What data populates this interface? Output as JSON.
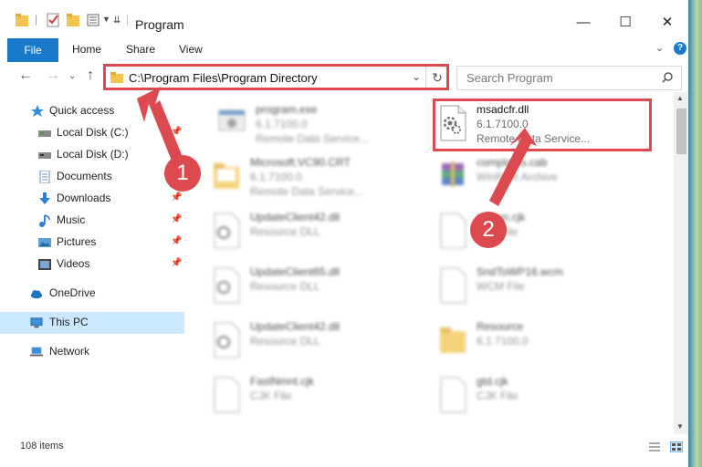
{
  "window": {
    "title": "Program",
    "minimize_glyph": "—",
    "maximize_glyph": "☐",
    "close_glyph": "✕"
  },
  "ribbon": {
    "file": "File",
    "tabs": [
      "Home",
      "Share",
      "View"
    ],
    "help_glyph": "?"
  },
  "address": {
    "path": "C:\\Program Files\\Program Directory",
    "search_placeholder": "Search Program"
  },
  "navigation": {
    "items": [
      {
        "label": "Quick access",
        "icon": "star-icon",
        "pinned": false
      },
      {
        "label": "Local Disk (C:)",
        "icon": "drive-icon",
        "pinned": true
      },
      {
        "label": "Local Disk (D:)",
        "icon": "drive-icon",
        "pinned": false
      },
      {
        "label": "Documents",
        "icon": "documents-icon",
        "pinned": true
      },
      {
        "label": "Downloads",
        "icon": "downloads-icon",
        "pinned": true
      },
      {
        "label": "Music",
        "icon": "music-icon",
        "pinned": true
      },
      {
        "label": "Pictures",
        "icon": "pictures-icon",
        "pinned": true
      },
      {
        "label": "Videos",
        "icon": "videos-icon",
        "pinned": true
      },
      {
        "label": "OneDrive",
        "icon": "cloud-icon",
        "pinned": false
      },
      {
        "label": "This PC",
        "icon": "pc-icon",
        "pinned": false,
        "selected": true
      },
      {
        "label": "Network",
        "icon": "network-icon",
        "pinned": false
      }
    ]
  },
  "files": [
    {
      "name": "program.exe",
      "line1": "6.1.7100.0",
      "line2": "Remote Data Service...",
      "icon": "exe-icon"
    },
    {
      "name": "msadcfr.dll",
      "line1": "6.1.7100.0",
      "line2": "Remote Data Service...",
      "icon": "dll-gear-icon",
      "highlight": true
    },
    {
      "name": "Microsoft.VC90.CRT",
      "line1": "6.1.7100.0",
      "line2": "Remote Data Service...",
      "icon": "folder-icon"
    },
    {
      "name": "complates.cab",
      "line1": "WinRAR Archive",
      "line2": "",
      "icon": "winrar-icon"
    },
    {
      "name": "UpdateClient42.dll",
      "line1": "Resource DLL",
      "line2": "",
      "icon": "dll-gear-icon"
    },
    {
      "name": "Updan.cjk",
      "line1": "CJK File",
      "line2": "",
      "icon": "blank-file-icon"
    },
    {
      "name": "UpdateClient65.dll",
      "line1": "Resource DLL",
      "line2": "",
      "icon": "dll-gear-icon"
    },
    {
      "name": "SndToWP16.wcm",
      "line1": "WCM File",
      "line2": "",
      "icon": "blank-file-icon"
    },
    {
      "name": "UpdateClient42.dll",
      "line1": "Resource DLL",
      "line2": "",
      "icon": "dll-gear-icon"
    },
    {
      "name": "Resource",
      "line1": "6.1.7100.0",
      "line2": "",
      "icon": "folder-icon"
    },
    {
      "name": "FastNmnt.cjk",
      "line1": "CJK File",
      "line2": "",
      "icon": "blank-file-icon"
    },
    {
      "name": "gtd.cjk",
      "line1": "CJK File",
      "line2": "",
      "icon": "blank-file-icon"
    }
  ],
  "status": {
    "count": "108 items"
  },
  "annotations": [
    {
      "number": "1",
      "color": "#dc4a4f"
    },
    {
      "number": "2",
      "color": "#dc4a4f"
    }
  ]
}
